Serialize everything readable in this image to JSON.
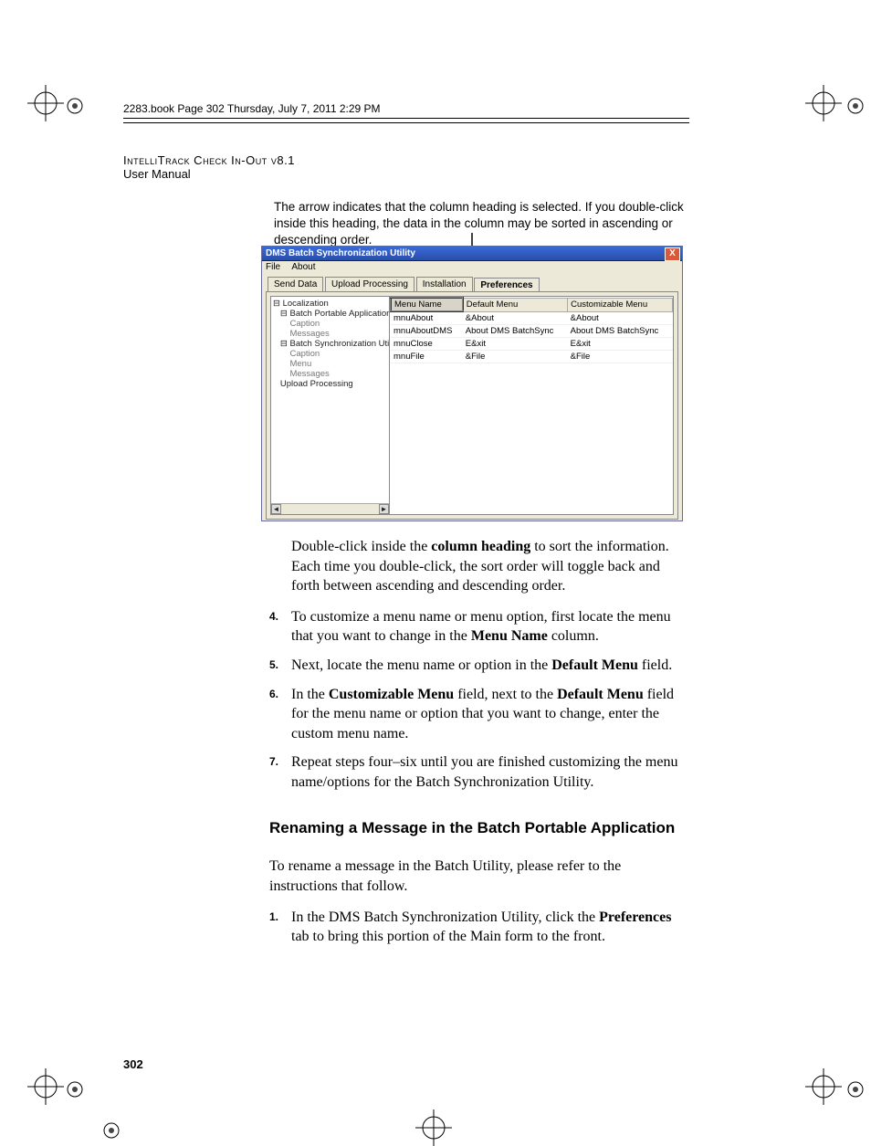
{
  "bookline": "2283.book  Page 302  Thursday, July 7, 2011  2:29 PM",
  "header_product": "IntelliTrack Check In-Out v8.1",
  "header_sub": "User Manual",
  "caption": "The arrow indicates that the column heading is selected. If you double-click inside this heading, the data in the column may be sorted in ascending or descending order.",
  "win": {
    "title": "DMS Batch Synchronization Utility",
    "close": "X",
    "menu": {
      "file": "File",
      "about": "About"
    },
    "tabs": {
      "send": "Send Data",
      "upload": "Upload Processing",
      "install": "Installation",
      "prefs": "Preferences"
    },
    "tree": [
      "⊟ Localization",
      "   ⊟ Batch Portable Application",
      "       Caption",
      "       Messages",
      "   ⊟ Batch Synchronization Utility",
      "       Caption",
      "       Menu",
      "       Messages",
      "   Upload Processing"
    ],
    "cols": {
      "c0": "Menu Name",
      "c1": "Default Menu",
      "c2": "Customizable Menu"
    },
    "rows": [
      {
        "c0": "mnuAbout",
        "c1": "&About",
        "c2": "&About"
      },
      {
        "c0": "mnuAboutDMS",
        "c1": "About DMS BatchSync",
        "c2": "About DMS BatchSync"
      },
      {
        "c0": "mnuClose",
        "c1": "E&xit",
        "c2": "E&xit"
      },
      {
        "c0": "mnuFile",
        "c1": "&File",
        "c2": "&File"
      }
    ],
    "scroll_left": "◄",
    "scroll_right": "►"
  },
  "para3a": "Double-click inside the ",
  "para3b": "column heading",
  "para3c": " to sort the information. Each time you double-click, the sort order will toggle back and forth between ascending and descending order.",
  "n4": "4.",
  "li4a": "To customize a menu name or menu option, first locate the menu that you want to change in the ",
  "li4b": "Menu Name",
  "li4c": " column.",
  "n5": "5.",
  "li5a": "Next, locate the menu name or option in the ",
  "li5b": "Default Menu",
  "li5c": " field.",
  "n6": "6.",
  "li6a": "In the ",
  "li6b": "Customizable Menu",
  "li6c": " field, next to the ",
  "li6d": "Default Menu",
  "li6e": " field for the menu name or option that you want to change, enter the custom menu name.",
  "n7": "7.",
  "li7": "Repeat steps four–six until you are finished customizing the menu name/options for the Batch Synchronization Utility.",
  "h2": "Renaming a Message in the Batch Portable Application",
  "intro2": "To rename a message in the Batch Utility, please refer to the instructions that follow.",
  "n1": "1.",
  "li1a": "In the DMS Batch Synchronization Utility, click the ",
  "li1b": "Preferences",
  "li1c": " tab to bring this portion of the Main form to the front.",
  "pagenum": "302"
}
